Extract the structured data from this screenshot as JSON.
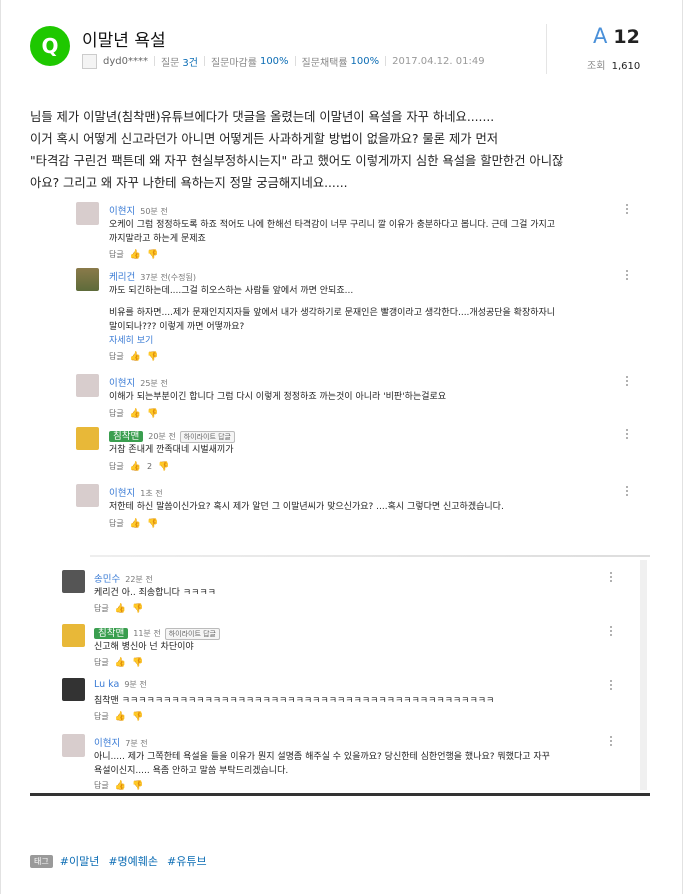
{
  "question": {
    "icon": "Q",
    "title": "이말년 욕설",
    "meta": {
      "username": "dyd0****",
      "questions_label": "질문",
      "questions_count": "3건",
      "deadline_label": "질문마감률",
      "deadline_rate": "100%",
      "adopt_label": "질문채택률",
      "adopt_rate": "100%",
      "date": "2017.04.12. 01:49"
    },
    "answers_icon": "A",
    "answers_count": "12",
    "views_label": "조회",
    "views_count": "1,610",
    "body": [
      "님들 제가 이말년(침착맨)유튜브에다가 댓글을 올렸는데 이말년이 욕설을 자꾸 하네요.......",
      "이거 혹시 어떻게 신고라던가 아니면 어떻게든 사과하게할 방법이 없을까요? 물론 제가 먼저",
      " \"타격감 구린건 팩튼데 왜 자꾸 현실부정하시는지\" 라고 했어도 이렇게까지 심한 욕설을 할만한건 아니잖",
      "아요? 그리고 왜 자꾸 나한테 욕하는지 정말 궁금해지네요......"
    ]
  },
  "comments": [
    {
      "name": "이현지",
      "time": "50분 전",
      "lines": [
        "오케이 그럼 정정하도록 하죠 적어도 나에 한해선 타격감이 너무 구리니 깔 이유가 충분하다고 봅니다. 근데 그걸 가지고",
        "까지말라고 하는게 문제죠"
      ],
      "reply": "답글"
    },
    {
      "name": "케리건",
      "time": "37분 전(수정됨)",
      "lines": [
        "까도 되긴하는데....그걸 히오스하는 사람들 앞에서 까면 안되죠...",
        "",
        "비유를 하자면....제가 문재인지지자들 앞에서 내가 생각하기로 문재인은 빨갱이라고 생각한다....개성공단을 확장하자니",
        "말이되나??? 이렇게 까면 어떻까요?"
      ],
      "more": "자세히 보기",
      "reply": "답글"
    },
    {
      "name": "이현지",
      "time": "25분 전",
      "lines": [
        "이해가 되는부분이긴 합니다 그럼 다시 이렇게 정정하죠 까는것이 아니라 '비판'하는걸로요"
      ],
      "reply": "답글"
    },
    {
      "name": "침착맨",
      "time": "20분 전",
      "badge": "하이라이트 답글",
      "lines": [
        "거참 존내게 깐족대네 시벌새끼가"
      ],
      "reply": "답글",
      "likes": "2"
    },
    {
      "name": "이현지",
      "time": "1초 전",
      "lines": [
        "저한테 하신 말씀이신가요? 혹시 제가 알던 그 이말년씨가 맞으신가요? ....혹시 그렇다면 신고하겠습니다."
      ],
      "reply": "답글"
    },
    {
      "name": "송민수",
      "time": "22분 전",
      "lines": [
        "케리건 아.. 죄송합니다 ㅋㅋㅋㅋ"
      ],
      "reply": "답글"
    },
    {
      "name": "침착맨",
      "time": "11분 전",
      "badge": "하이라이트 답글",
      "lines": [
        "신고해 병신아 넌 차단이야"
      ],
      "reply": "답글"
    },
    {
      "name": "Lu ka",
      "time": "9분 전",
      "lines": [
        "침착맨 ㅋㅋㅋㅋㅋㅋㅋㅋㅋㅋㅋㅋㅋㅋㅋㅋㅋㅋㅋㅋㅋㅋㅋㅋㅋㅋㅋㅋㅋㅋㅋㅋㅋㅋㅋㅋㅋㅋㅋㅋㅋㅋㅋㅋㅋ"
      ],
      "reply": "답글"
    },
    {
      "name": "이현지",
      "time": "7분 전",
      "lines": [
        "아니..... 제가 그쪽한테 욕설을 들을 이유가 뭔지 설명좀 해주실 수 있을까요? 당신한테 심한언행을 했나요? 뭐했다고 자꾸",
        "욕설이신지..... 욕좀 안하고 말씀 부탁드리겠습니다."
      ],
      "reply": "답글"
    }
  ],
  "tags": {
    "label": "태그",
    "items": [
      "#이말년",
      "#명예훼손",
      "#유튜브"
    ]
  },
  "colors": {
    "brand_green": "#1ec800",
    "link_blue": "#3a7bd5",
    "answer_blue": "#4a90d9"
  }
}
